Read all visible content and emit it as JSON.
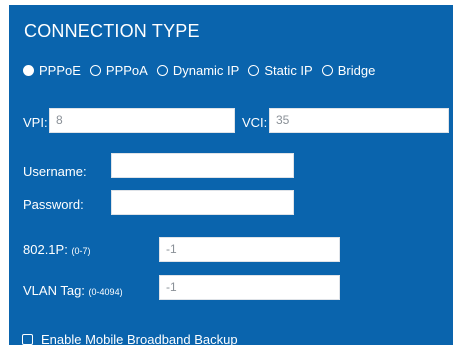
{
  "section": {
    "title": "CONNECTION TYPE"
  },
  "connection_types": [
    {
      "label": "PPPoE",
      "selected": true
    },
    {
      "label": "PPPoA",
      "selected": false
    },
    {
      "label": "Dynamic IP",
      "selected": false
    },
    {
      "label": "Static IP",
      "selected": false
    },
    {
      "label": "Bridge",
      "selected": false
    }
  ],
  "fields": {
    "vpi": {
      "label": "VPI:",
      "value": "8"
    },
    "vci": {
      "label": "VCI:",
      "value": "35"
    },
    "username": {
      "label": "Username:",
      "value": ""
    },
    "password": {
      "label": "Password:",
      "value": ""
    },
    "priority": {
      "label": "802.1P:",
      "hint": "(0-7)",
      "value": "-1"
    },
    "vlan": {
      "label": "VLAN Tag:",
      "hint": "(0-4094)",
      "value": "-1"
    }
  },
  "backup": {
    "label": "Enable Mobile Broadband Backup",
    "checked": false
  },
  "colors": {
    "panel_bg": "#0a64ad",
    "text": "#ffffff"
  }
}
